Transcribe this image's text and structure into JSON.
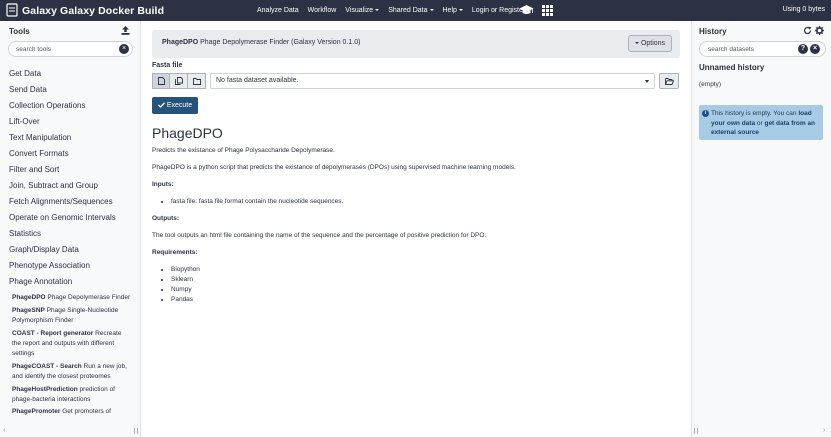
{
  "app": {
    "title": "Galaxy Galaxy Docker Build",
    "usage": "Using 0 bytes"
  },
  "nav": {
    "items": [
      {
        "label": "Analyze Data",
        "dropdown": false
      },
      {
        "label": "Workflow",
        "dropdown": false
      },
      {
        "label": "Visualize",
        "dropdown": true
      },
      {
        "label": "Shared Data",
        "dropdown": true
      },
      {
        "label": "Help",
        "dropdown": true
      },
      {
        "label": "Login or Register",
        "dropdown": false
      }
    ],
    "icons": [
      "graduation-cap-icon",
      "grid-icon"
    ]
  },
  "tools_panel": {
    "title": "Tools",
    "search_placeholder": "search tools",
    "sections": [
      "Get Data",
      "Send Data",
      "Collection Operations",
      "Lift-Over",
      "Text Manipulation",
      "Convert Formats",
      "Filter and Sort",
      "Join, Subtract and Group",
      "Fetch Alignments/Sequences",
      "Operate on Genomic Intervals",
      "Statistics",
      "Graph/Display Data",
      "Phenotype Association",
      "Phage Annotation"
    ],
    "tools": [
      {
        "name": "PhageDPO",
        "desc": " Phage Depolymerase Finder"
      },
      {
        "name": "PhageSNP",
        "desc": " Phage Single-Nucleotide Polymorphism Finder"
      },
      {
        "name": "COAST - Report generator",
        "desc": " Recreate the report and outputs with different settings"
      },
      {
        "name": "PhageCOAST - Search",
        "desc": " Run a new job, and identify the closest proteomes"
      },
      {
        "name": "PhageHostPrediction",
        "desc": " prediction of phage-bacteria interactions"
      },
      {
        "name": "PhagePromoter",
        "desc": " Get promoters of"
      }
    ]
  },
  "tool_form": {
    "name": "PhageDPO",
    "description": " Phage Depolymerase Finder (Galaxy Version 0.1.0)",
    "options_label": "Options",
    "field_label": "Fasta file",
    "select_value": "No fasta dataset available.",
    "execute_label": "Execute"
  },
  "help": {
    "title": "PhageDPO",
    "summary": "Predicts the existance of Phage Polysaccharide Depolymerase.",
    "intro": "PhageDPO is a python script that predicts the existance of depolymerases (DPOs) using supervised machine learning models.",
    "inputs_label": "Inputs:",
    "inputs": [
      "fasta file: fasta file format contain the nucleotide sequences."
    ],
    "outputs_label": "Outputs:",
    "outputs_text": "The tool outputs an html file containing the name of the sequence and the percentage of positive prediction for DPO.",
    "requirements_label": "Requirements:",
    "requirements": [
      "Biopython",
      "Sklearn",
      "Numpy",
      "Pandas"
    ]
  },
  "history": {
    "title": "History",
    "search_placeholder": "search datasets",
    "name": "Unnamed history",
    "size": "(empty)",
    "info_pre": "This history is empty. You can ",
    "info_link1": "load your own data",
    "info_mid": " or ",
    "info_link2": "get data from an external source"
  },
  "colors": {
    "navbar": "#2c3143",
    "execute": "#25537b",
    "info_box": "#a8cbe5"
  }
}
